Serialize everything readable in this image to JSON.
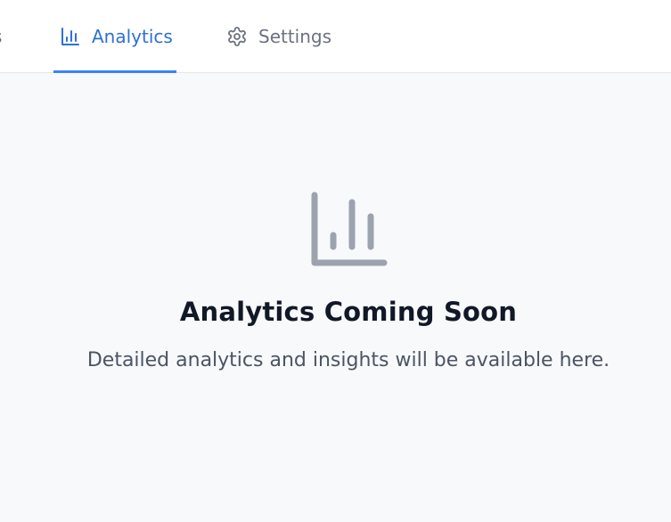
{
  "tabs": {
    "partial_label": "s",
    "analytics_label": "Analytics",
    "settings_label": "Settings",
    "active": "Analytics"
  },
  "icons": {
    "analytics_tab": "bar-chart-icon",
    "settings_tab": "gear-icon",
    "empty_state": "bar-chart-icon"
  },
  "empty_state": {
    "title": "Analytics Coming Soon",
    "description": "Detailed analytics and insights will be available here."
  },
  "colors": {
    "accent": "#3b82f6",
    "active_text": "#2f6fd6",
    "muted_icon": "#9ca3af",
    "background": "#f8f9fb"
  }
}
